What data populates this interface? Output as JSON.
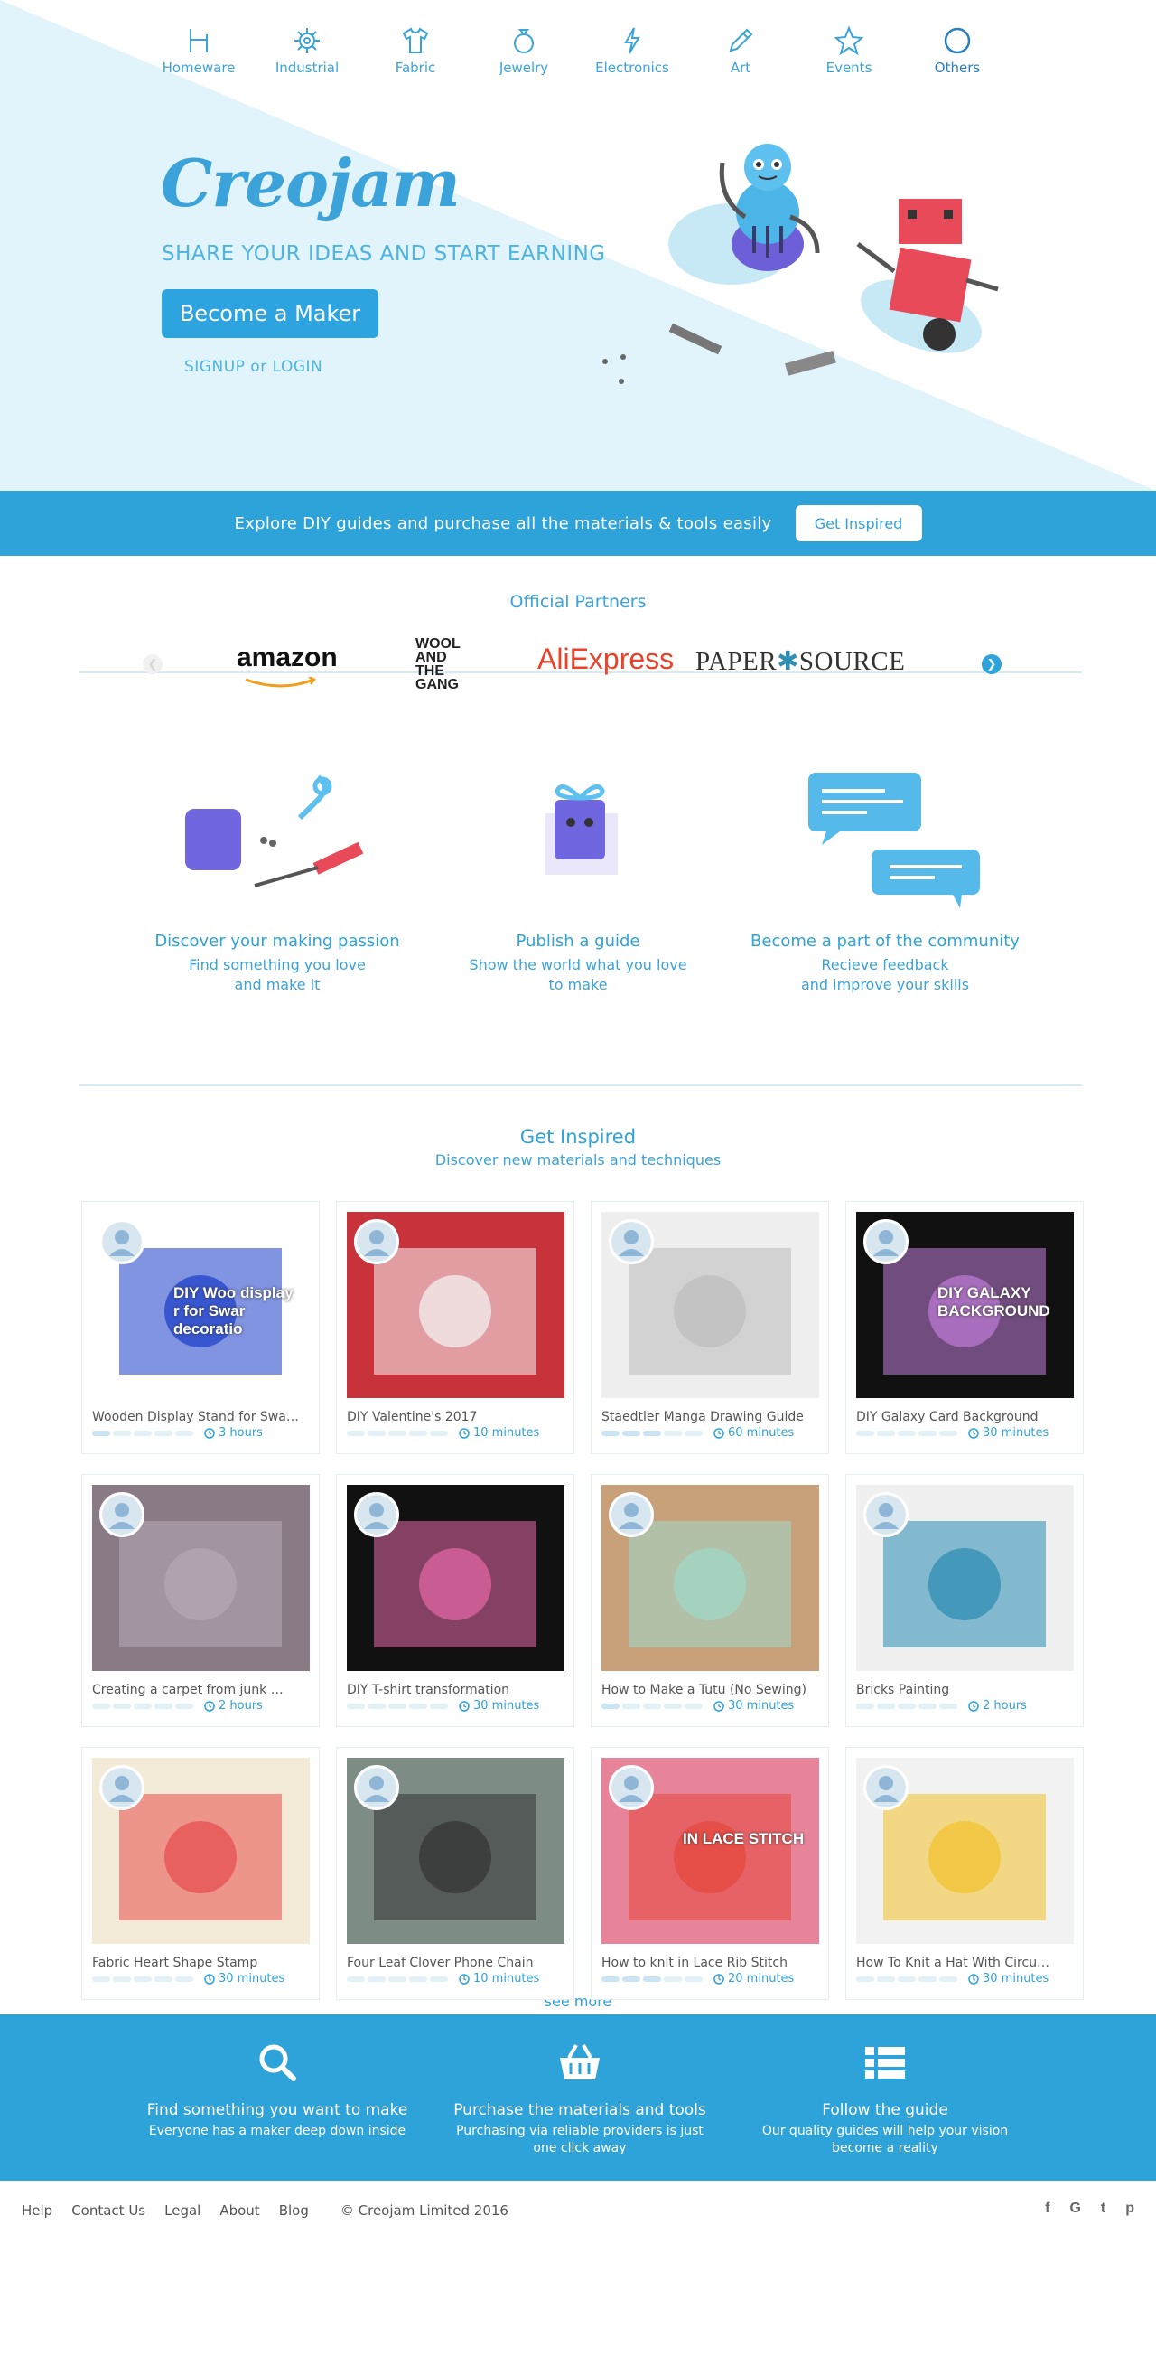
{
  "nav": {
    "categories": [
      {
        "label": "Homeware",
        "icon": "chair-icon"
      },
      {
        "label": "Industrial",
        "icon": "gear-icon"
      },
      {
        "label": "Fabric",
        "icon": "tshirt-icon"
      },
      {
        "label": "Jewelry",
        "icon": "ring-icon"
      },
      {
        "label": "Electronics",
        "icon": "lightning-icon"
      },
      {
        "label": "Art",
        "icon": "pencil-icon"
      },
      {
        "label": "Events",
        "icon": "star-icon"
      },
      {
        "label": "Others",
        "icon": "circle-icon"
      }
    ]
  },
  "hero": {
    "logo": "Creojam",
    "tagline": "SHARE YOUR IDEAS AND START EARNING",
    "cta_label": "Become a Maker",
    "signup_label": "SIGNUP or LOGIN"
  },
  "banner": {
    "text": "Explore DIY guides and purchase all the materials & tools easily",
    "button_label": "Get Inspired"
  },
  "partners": {
    "title": "Official Partners",
    "logos": {
      "amazon": "amazon",
      "wool": "WOOL AND THE GANG",
      "aliexpress": "AliExpress",
      "paper_source_left": "PAPER",
      "paper_source_right": "SOURCE"
    }
  },
  "features": [
    {
      "title": "Discover your making passion",
      "desc": "Find something you love\nand make it"
    },
    {
      "title": "Publish a guide",
      "desc": "Show the world what you love\nto make"
    },
    {
      "title": "Become a part of the community",
      "desc": "Recieve feedback\nand improve your skills"
    }
  ],
  "inspired": {
    "title": "Get Inspired",
    "subtitle": "Discover new materials and techniques",
    "see_more": "see more",
    "cards": [
      {
        "title": "Wooden Display Stand for Swa…",
        "time": "3 hours",
        "level": 0.25,
        "thumb_text": "DIY Woo display r for Swar decoratio"
      },
      {
        "title": "DIY Valentine's 2017",
        "time": "10 minutes",
        "level": 0.0,
        "thumb_text": ""
      },
      {
        "title": "Staedtler Manga Drawing Guide",
        "time": "60 minutes",
        "level": 0.5,
        "thumb_text": ""
      },
      {
        "title": "DIY Galaxy Card Background",
        "time": "30 minutes",
        "level": 0.0,
        "thumb_text": "DIY GALAXY BACKGROUND"
      },
      {
        "title": "Creating a carpet from junk …",
        "time": "2 hours",
        "level": 0.0,
        "thumb_text": ""
      },
      {
        "title": "DIY T-shirt transformation",
        "time": "30 minutes",
        "level": 0.0,
        "thumb_text": ""
      },
      {
        "title": "How to Make a Tutu (No Sewing)",
        "time": "30 minutes",
        "level": 0.25,
        "thumb_text": ""
      },
      {
        "title": "Bricks Painting",
        "time": "2 hours",
        "level": 0.0,
        "thumb_text": ""
      },
      {
        "title": "Fabric Heart Shape Stamp",
        "time": "30 minutes",
        "level": 0.0,
        "thumb_text": ""
      },
      {
        "title": "Four Leaf Clover Phone Chain",
        "time": "10 minutes",
        "level": 0.0,
        "thumb_text": ""
      },
      {
        "title": "How to knit in Lace Rib Stitch",
        "time": "20 minutes",
        "level": 0.5,
        "thumb_text": "IN LACE STITCH"
      },
      {
        "title": "How To Knit a Hat With Circu…",
        "time": "30 minutes",
        "level": 0.0,
        "thumb_text": ""
      }
    ]
  },
  "footer_features": [
    {
      "title": "Find something you want to make",
      "desc": "Everyone has a maker deep down inside",
      "icon": "search-icon"
    },
    {
      "title": "Purchase the materials and tools",
      "desc": "Purchasing via reliable providers is just\none click away",
      "icon": "basket-icon"
    },
    {
      "title": "Follow the guide",
      "desc": "Our quality guides will help your vision\nbecome a reality",
      "icon": "list-icon"
    }
  ],
  "footer": {
    "links": [
      "Help",
      "Contact Us",
      "Legal",
      "About",
      "Blog"
    ],
    "copyright": "© Creojam Limited 2016",
    "social": [
      {
        "label": "f",
        "icon": "facebook-icon"
      },
      {
        "label": "G",
        "icon": "google-icon"
      },
      {
        "label": "t",
        "icon": "twitter-icon"
      },
      {
        "label": "p",
        "icon": "pinterest-icon"
      }
    ]
  },
  "colors": {
    "accent": "#2ea3da",
    "hero_bg": "#e1f4fb"
  }
}
